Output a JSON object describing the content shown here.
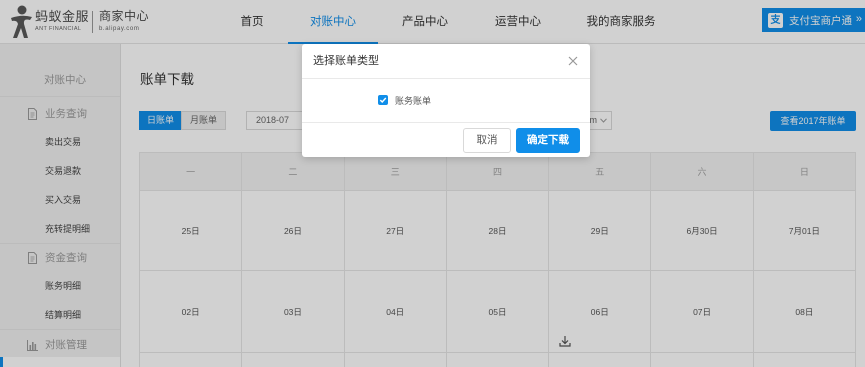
{
  "header": {
    "logo": {
      "icon": "ant-financial-logo-icon",
      "name": "蚂蚁金服",
      "sub": "ANT FINANCIAL"
    },
    "site": {
      "name": "商家中心",
      "sub": "b.alipay.com"
    },
    "nav": [
      {
        "label": "首页",
        "active": false
      },
      {
        "label": "对账中心",
        "active": true
      },
      {
        "label": "产品中心",
        "active": false
      },
      {
        "label": "运营中心",
        "active": false
      },
      {
        "label": "我的商家服务",
        "active": false
      }
    ],
    "promo": {
      "icon": "alipay-icon",
      "icon_glyph": "支",
      "label": "支付宝商户通",
      "arrow": "»"
    }
  },
  "sidebar": {
    "title": "对账中心",
    "groups": [
      {
        "icon": "file-icon",
        "label": "业务查询",
        "items": [
          "卖出交易",
          "交易退款",
          "买入交易",
          "充转提明细"
        ]
      },
      {
        "icon": "file-icon",
        "label": "资金查询",
        "items": [
          "账务明细",
          "结算明细"
        ]
      },
      {
        "icon": "bar-chart-icon",
        "label": "对账管理",
        "items": []
      }
    ]
  },
  "main": {
    "title": "账单下载",
    "tabs": [
      {
        "label": "日账单",
        "active": true
      },
      {
        "label": "月账单",
        "active": false
      }
    ],
    "month_picker": {
      "value": "2018-07"
    },
    "filter_select": {
      "visible_text": "m",
      "icon": "chevron-down-icon"
    },
    "history_button": "查看2017年账单",
    "calendar": {
      "weekdays": [
        "一",
        "二",
        "三",
        "四",
        "五",
        "六",
        "日"
      ],
      "weeks": [
        [
          "25日",
          "26日",
          "27日",
          "28日",
          "29日",
          "6月30日",
          "7月01日"
        ],
        [
          "02日",
          "03日",
          "04日",
          "05日",
          "06日",
          "07日",
          "08日"
        ]
      ],
      "download_icon": "download-icon"
    }
  },
  "modal": {
    "title": "选择账单类型",
    "close_icon": "close-icon",
    "options": [
      {
        "label": "账务账单",
        "checked": true
      }
    ],
    "cancel_label": "取消",
    "confirm_label": "确定下载"
  },
  "colors": {
    "accent": "#108ee9"
  }
}
